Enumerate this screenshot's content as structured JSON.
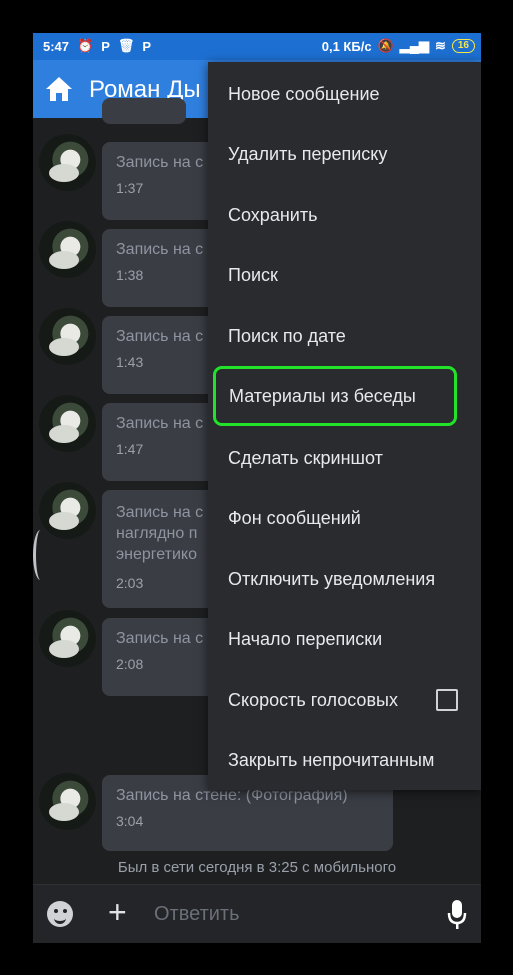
{
  "status": {
    "time": "5:47",
    "speed": "0,1 КБ/с",
    "battery": "16"
  },
  "appbar": {
    "title": "Роман Ды"
  },
  "messages": [
    {
      "text": [
        "Запись на с"
      ],
      "time": "1:37"
    },
    {
      "text": [
        "Запись на с"
      ],
      "time": "1:38"
    },
    {
      "text": [
        "Запись на с"
      ],
      "time": "1:43"
    },
    {
      "text": [
        "Запись на с"
      ],
      "time": "1:47"
    },
    {
      "text": [
        "Запись на с",
        "наглядно п",
        "энергетико"
      ],
      "time": "2:03"
    },
    {
      "text": [
        "Запись на с"
      ],
      "time": "2:08"
    },
    {
      "text": [
        "Запись на стене:  (Фотография)"
      ],
      "time": "3:04"
    }
  ],
  "presence": "Был в сети сегодня в 3:25 с мобильного",
  "input": {
    "placeholder": "Ответить"
  },
  "menu": {
    "items": [
      "Новое сообщение",
      "Удалить переписку",
      "Сохранить",
      "Поиск",
      "Поиск по дате",
      "Материалы из беседы",
      "Сделать скриншот",
      "Фон сообщений",
      "Отключить уведомления",
      "Начало переписки",
      "Скорость голосовых",
      "Закрыть непрочитанным"
    ],
    "highlighted_index": 5,
    "voice_speed_checked": false
  },
  "colors": {
    "accent": "#2f7fdf",
    "highlight": "#22e32a",
    "background": "#1e1f21"
  }
}
